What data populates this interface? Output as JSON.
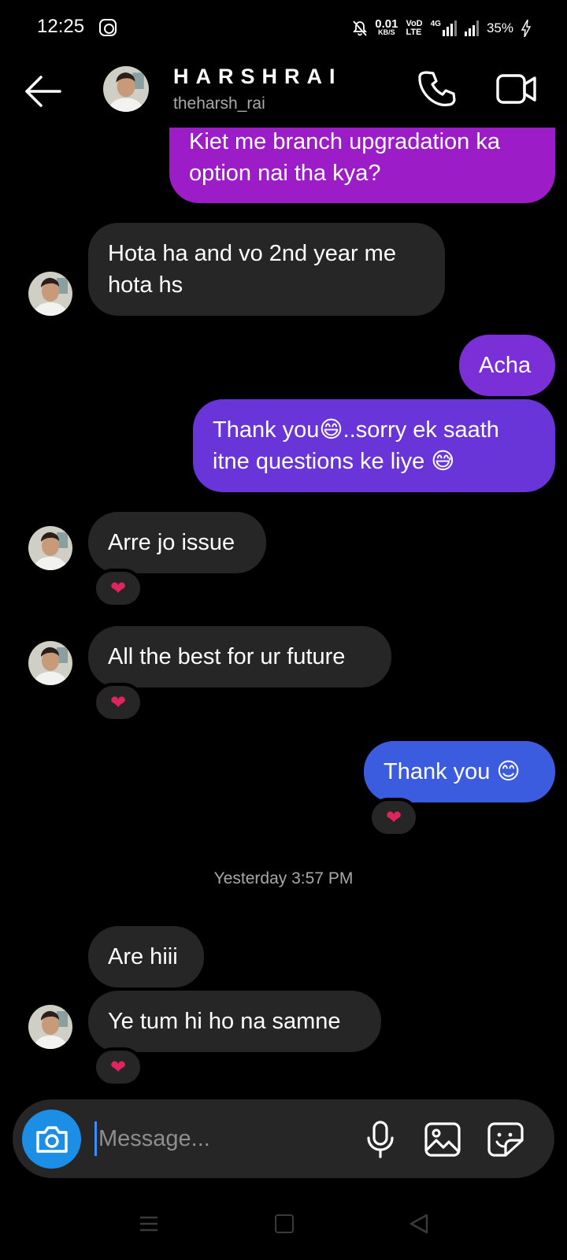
{
  "status": {
    "time": "12:25",
    "speed_value": "0.01",
    "speed_unit": "KB/S",
    "vo_top": "VoD",
    "vo_bottom": "LTE",
    "network": "4G",
    "battery": "35%"
  },
  "header": {
    "name": "HARSHRAI",
    "username": "theharsh_rai"
  },
  "messages": [
    {
      "text": "Kiet me branch upgradation ka option nai tha kya?"
    },
    {
      "text": "Hota ha and vo 2nd year me hota hs"
    },
    {
      "text": "Acha"
    },
    {
      "text": "Thank you😄..sorry ek saath itne questions ke liye 😅"
    },
    {
      "text": "Arre jo issue",
      "reaction": "❤"
    },
    {
      "text": "All the best for ur future",
      "reaction": "❤"
    },
    {
      "text": "Thank you 😊",
      "reaction": "❤"
    },
    {
      "text": "Are hiii"
    },
    {
      "text": "Ye tum hi ho na samne",
      "reaction": "❤"
    }
  ],
  "timestamp": "Yesterday 3:57 PM",
  "composer": {
    "placeholder": "Message..."
  },
  "colors": {
    "outgoing_1": "#9c1cc7",
    "outgoing_2": "#7b2fd6",
    "outgoing_3": "#6a35d8",
    "outgoing_4": "#3c5ce0",
    "incoming": "#262626",
    "camera_button": "#1d8ee6"
  },
  "icons": [
    "back-arrow-icon",
    "phone-icon",
    "video-camera-icon",
    "camera-icon",
    "microphone-icon",
    "gallery-icon",
    "sticker-icon",
    "heart-icon"
  ]
}
